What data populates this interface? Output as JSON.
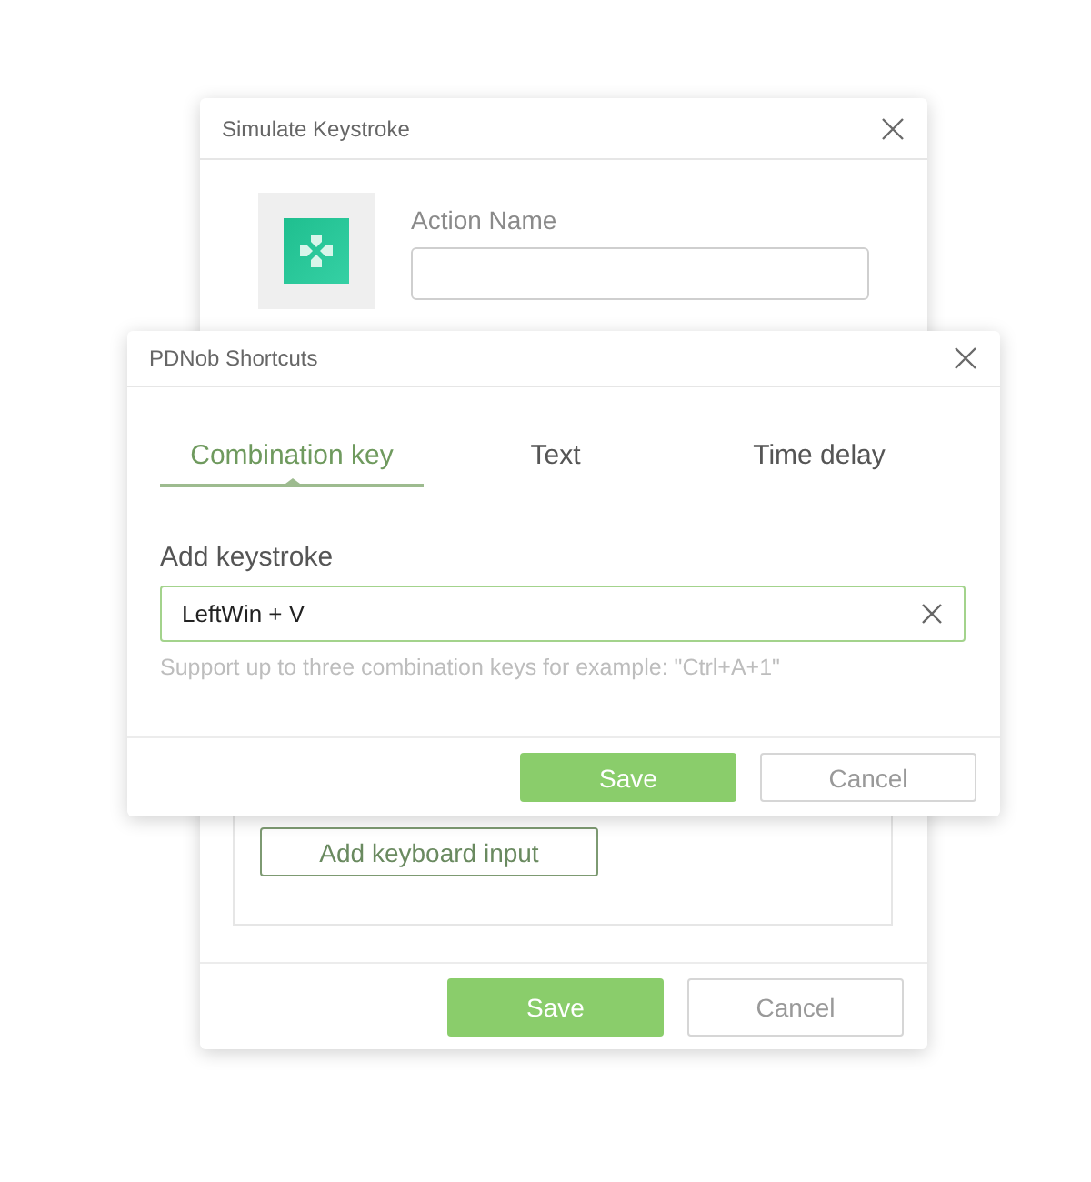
{
  "back_dialog": {
    "title": "Simulate Keystroke",
    "action_name": {
      "label": "Action Name"
    },
    "add_input_button": "Add keyboard input",
    "buttons": [
      {
        "label": "Save",
        "kind": "primary"
      },
      {
        "label": "Cancel",
        "kind": "secondary"
      }
    ]
  },
  "front_dialog": {
    "title": "PDNob Shortcuts",
    "tabs": [
      {
        "label": "Combination key",
        "selected": true
      },
      {
        "label": "Text",
        "selected": false
      },
      {
        "label": "Time delay",
        "selected": false
      }
    ],
    "keystroke_field": {
      "label": "Add keystroke",
      "value": "LeftWin + V",
      "focused": true
    },
    "help_text": "Support up to three combination keys for example: \"Ctrl+A+1\"",
    "buttons": [
      {
        "label": "Save",
        "kind": "primary"
      },
      {
        "label": "Cancel",
        "kind": "secondary"
      }
    ]
  }
}
